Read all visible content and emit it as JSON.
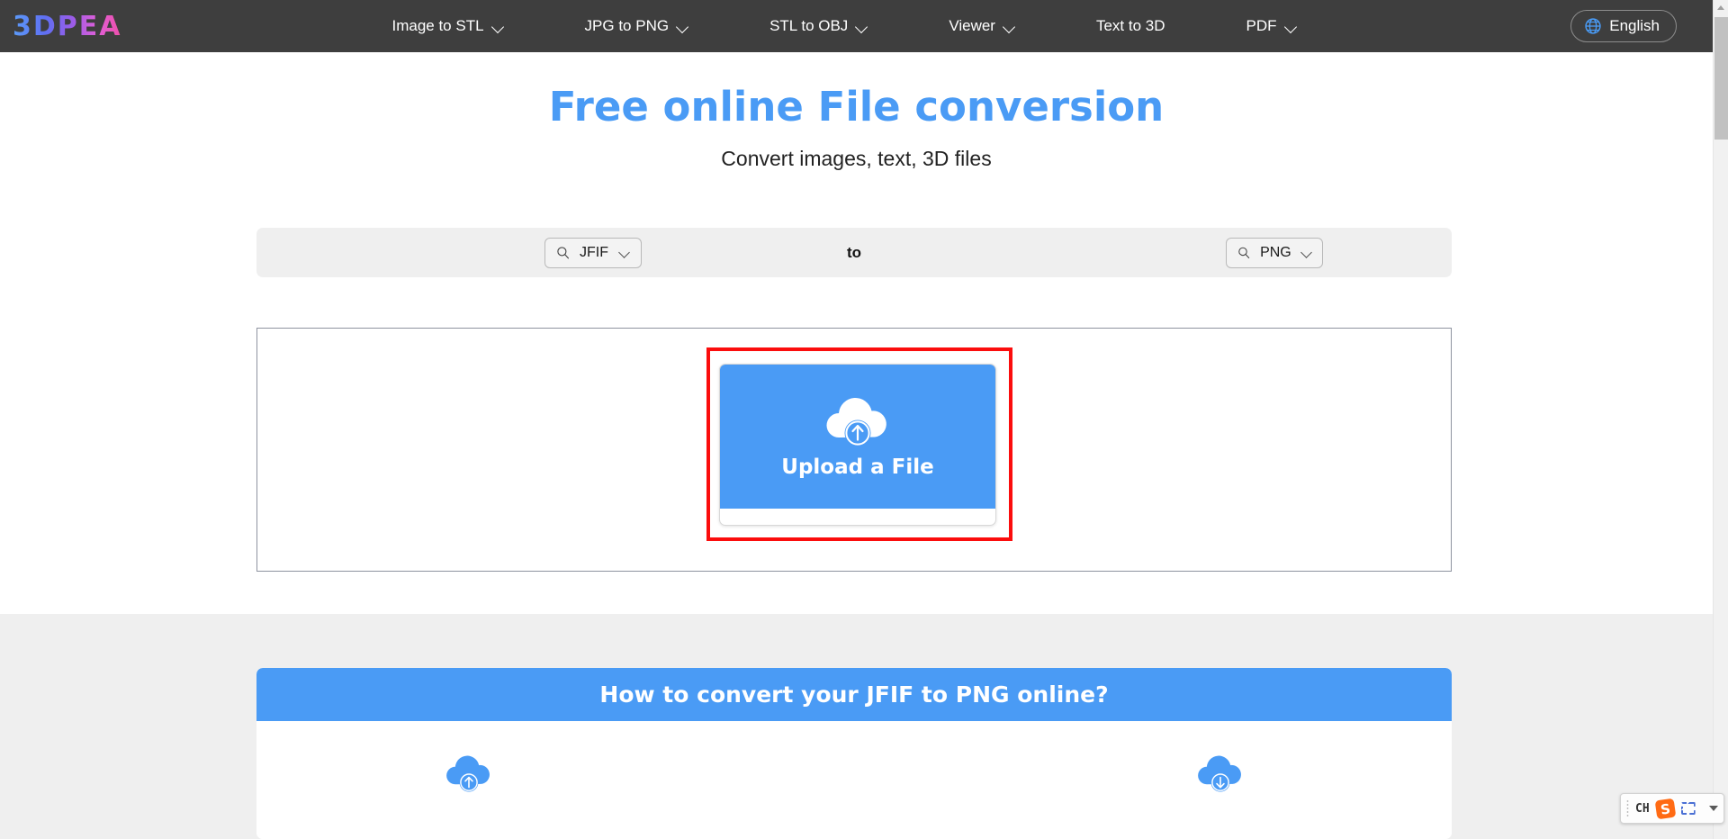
{
  "navbar": {
    "logo_text": "3DPEA",
    "items": [
      {
        "label": "Image to STL",
        "has_dropdown": true
      },
      {
        "label": "JPG to PNG",
        "has_dropdown": true
      },
      {
        "label": "STL to OBJ",
        "has_dropdown": true
      },
      {
        "label": "Viewer",
        "has_dropdown": true
      },
      {
        "label": "Text to 3D",
        "has_dropdown": false
      },
      {
        "label": "PDF",
        "has_dropdown": true
      }
    ],
    "language_button": {
      "label": "English",
      "icon": "globe-icon"
    }
  },
  "hero": {
    "title": "Free online File conversion",
    "subtitle": "Convert images, text, 3D files",
    "title_color": "#4a9bf5"
  },
  "converter": {
    "source_format": "JFIF",
    "target_format": "PNG",
    "separator_label": "to",
    "source_icon": "search-icon",
    "target_icon": "search-icon",
    "dropdown_icon": "chevron-down-icon"
  },
  "dropzone": {
    "upload_button_label": "Upload a File",
    "upload_icon": "cloud-upload-icon",
    "highlight_color": "#fb0d0d",
    "button_color": "#4a9bf5"
  },
  "howto": {
    "heading": "How to convert your JFIF to PNG online?",
    "header_color": "#4a9bf5",
    "steps": [
      {
        "icon": "cloud-upload-icon"
      },
      {
        "icon": "cloud-download-icon"
      }
    ]
  },
  "ime": {
    "language_code": "CH",
    "logo_letter": "S",
    "keyboard_icon": "keyboard-icon",
    "expand_icon": "caret-down-icon"
  },
  "scrollbar": {
    "up_arrow_icon": "scroll-up-arrow-icon"
  }
}
